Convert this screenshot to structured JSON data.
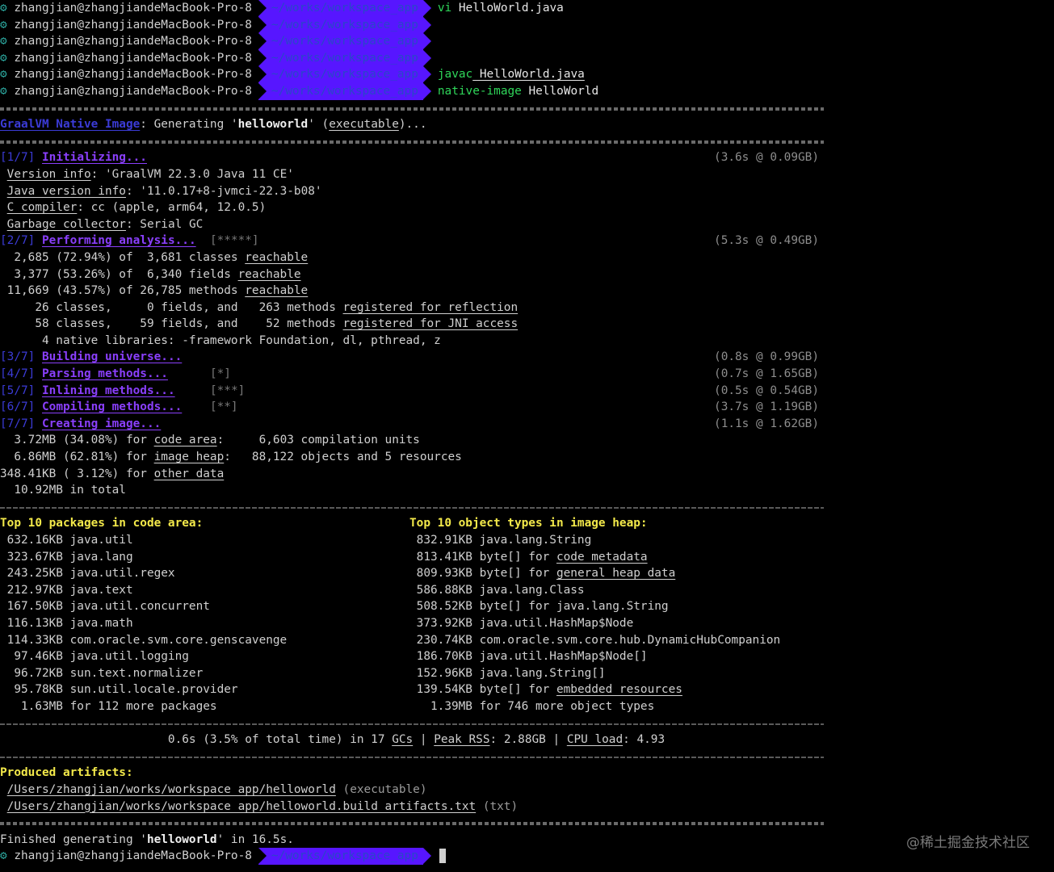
{
  "prompt": {
    "host": "zhangjian@zhangjiandeMacBook-Pro-8",
    "path": "~/works/workspace_app",
    "gear_glyph": "⚙"
  },
  "history": [
    {
      "cmd_kw": "vi",
      "cmd_rest": " HelloWorld.java"
    },
    {
      "cmd_kw": "",
      "cmd_rest": ""
    },
    {
      "cmd_kw": "",
      "cmd_rest": ""
    },
    {
      "cmd_kw": "",
      "cmd_rest": ""
    },
    {
      "cmd_kw": "javac",
      "cmd_rest": " HelloWorld.java"
    },
    {
      "cmd_kw": "native-image",
      "cmd_rest": " HelloWorld"
    }
  ],
  "header": {
    "brand": "GraalVM Native Image",
    "text_a": ": Generating '",
    "name": "helloworld",
    "text_b": "' (",
    "kind": "executable",
    "text_c": ")..."
  },
  "stages": {
    "s1": {
      "num": "[1/7]",
      "label": "Initializing...",
      "progress": "",
      "time": "(3.6s @ 0.09GB)"
    },
    "s2": {
      "num": "[2/7]",
      "label": "Performing analysis...",
      "progress": "[*****]",
      "time": "(5.3s @ 0.49GB)"
    },
    "s3": {
      "num": "[3/7]",
      "label": "Building universe...",
      "progress": "",
      "time": "(0.8s @ 0.99GB)"
    },
    "s4": {
      "num": "[4/7]",
      "label": "Parsing methods...",
      "progress": "[*]",
      "time": "(0.7s @ 1.65GB)"
    },
    "s5": {
      "num": "[5/7]",
      "label": "Inlining methods...",
      "progress": "[***]",
      "time": "(0.5s @ 0.54GB)"
    },
    "s6": {
      "num": "[6/7]",
      "label": "Compiling methods...",
      "progress": "[**]",
      "time": "(3.7s @ 1.19GB)"
    },
    "s7": {
      "num": "[7/7]",
      "label": "Creating image...",
      "progress": "",
      "time": "(1.1s @ 1.62GB)"
    }
  },
  "info": {
    "version_k": "Version info",
    "version_v": ": 'GraalVM 22.3.0 Java 11 CE'",
    "java_k": "Java version info",
    "java_v": ": '11.0.17+8-jvmci-22.3-b08'",
    "c_k": "C compiler",
    "c_v": ": cc (apple, arm64, 12.0.5)",
    "gc_k": "Garbage collector",
    "gc_v": ": Serial GC"
  },
  "analysis": {
    "classes_a": "  2,685 (72.94%) of  3,681 classes ",
    "classes_b": "reachable",
    "fields_a": "  3,377 (53.26%) of  6,340 fields ",
    "fields_b": "reachable",
    "methods_a": " 11,669 (43.57%) of 26,785 methods ",
    "methods_b": "reachable",
    "refl_a": "     26 classes,     0 fields, and   263 methods ",
    "refl_b": "registered for reflection",
    "jni_a": "     58 classes,    59 fields, and    52 methods ",
    "jni_b": "registered for JNI access",
    "native": "      4 native libraries: -framework Foundation, dl, pthread, z"
  },
  "image": {
    "code_a": "  3.72MB (34.08%) for ",
    "code_k": "code area",
    "code_b": ":     6,603 compilation units",
    "heap_a": "  6.86MB (62.81%) for ",
    "heap_k": "image heap",
    "heap_b": ":   88,122 objects and 5 resources",
    "other_a": "348.41KB ( 3.12%) for ",
    "other_k": "other data",
    "total": "  10.92MB in total"
  },
  "packages": {
    "title": "Top 10 packages in code area:",
    "rows": [
      " 632.16KB java.util",
      " 323.67KB java.lang",
      " 243.25KB java.util.regex",
      " 212.97KB java.text",
      " 167.50KB java.util.concurrent",
      " 116.13KB java.math",
      " 114.33KB com.oracle.svm.core.genscavenge",
      "  97.46KB java.util.logging",
      "  96.72KB sun.text.normalizer",
      "  95.78KB sun.util.locale.provider",
      "   1.63MB for 112 more packages"
    ]
  },
  "objects": {
    "title": "Top 10 object types in image heap:",
    "rows": [
      {
        "a": " 832.91KB java.lang.String",
        "u": "",
        "b": ""
      },
      {
        "a": " 813.41KB byte[] for ",
        "u": "code metadata",
        "b": ""
      },
      {
        "a": " 809.93KB byte[] for ",
        "u": "general heap data",
        "b": ""
      },
      {
        "a": " 586.88KB java.lang.Class",
        "u": "",
        "b": ""
      },
      {
        "a": " 508.52KB byte[] for java.lang.String",
        "u": "",
        "b": ""
      },
      {
        "a": " 373.92KB java.util.HashMap$Node",
        "u": "",
        "b": ""
      },
      {
        "a": " 230.74KB com.oracle.svm.core.hub.DynamicHubCompanion",
        "u": "",
        "b": ""
      },
      {
        "a": " 186.70KB java.util.HashMap$Node[]",
        "u": "",
        "b": ""
      },
      {
        "a": " 152.96KB java.lang.String[]",
        "u": "",
        "b": ""
      },
      {
        "a": " 139.54KB byte[] for ",
        "u": "embedded resources",
        "b": ""
      },
      {
        "a": "   1.39MB for 746 more object types",
        "u": "",
        "b": ""
      }
    ]
  },
  "gc": {
    "a": "                        0.6s (3.5% of total time) in 17 ",
    "gcs": "GCs",
    "b": " | ",
    "rss": "Peak RSS",
    "c": ": 2.88GB | ",
    "cpu": "CPU load",
    "d": ": 4.93"
  },
  "artifacts": {
    "title": "Produced artifacts:",
    "a1_path": "/Users/zhangjian/works/workspace_app/helloworld",
    "a1_kind": " (executable)",
    "a2_path": "/Users/zhangjian/works/workspace_app/helloworld.build_artifacts.txt",
    "a2_kind": " (txt)"
  },
  "finished": {
    "a": "Finished generating '",
    "name": "helloworld",
    "b": "' in 16.5s."
  },
  "watermark": "@稀土掘金技术社区"
}
